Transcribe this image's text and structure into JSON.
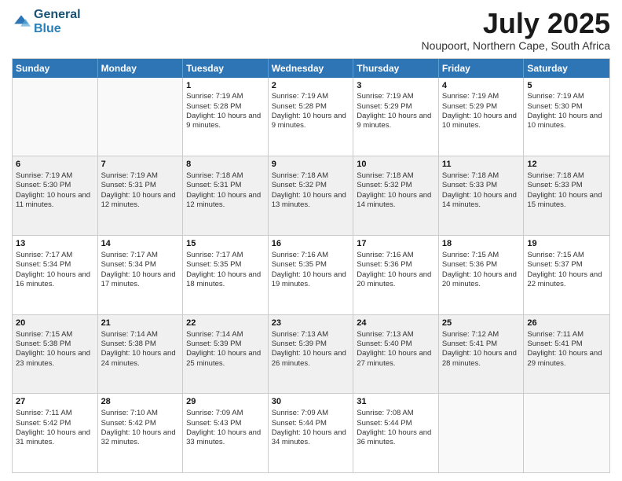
{
  "header": {
    "logo_line1": "General",
    "logo_line2": "Blue",
    "title": "July 2025",
    "subtitle": "Noupoort, Northern Cape, South Africa"
  },
  "calendar": {
    "days_of_week": [
      "Sunday",
      "Monday",
      "Tuesday",
      "Wednesday",
      "Thursday",
      "Friday",
      "Saturday"
    ],
    "weeks": [
      [
        {
          "day": "",
          "info": "",
          "empty": true
        },
        {
          "day": "",
          "info": "",
          "empty": true
        },
        {
          "day": "1",
          "info": "Sunrise: 7:19 AM\nSunset: 5:28 PM\nDaylight: 10 hours and 9 minutes."
        },
        {
          "day": "2",
          "info": "Sunrise: 7:19 AM\nSunset: 5:28 PM\nDaylight: 10 hours and 9 minutes."
        },
        {
          "day": "3",
          "info": "Sunrise: 7:19 AM\nSunset: 5:29 PM\nDaylight: 10 hours and 9 minutes."
        },
        {
          "day": "4",
          "info": "Sunrise: 7:19 AM\nSunset: 5:29 PM\nDaylight: 10 hours and 10 minutes."
        },
        {
          "day": "5",
          "info": "Sunrise: 7:19 AM\nSunset: 5:30 PM\nDaylight: 10 hours and 10 minutes."
        }
      ],
      [
        {
          "day": "6",
          "info": "Sunrise: 7:19 AM\nSunset: 5:30 PM\nDaylight: 10 hours and 11 minutes.",
          "shaded": true
        },
        {
          "day": "7",
          "info": "Sunrise: 7:19 AM\nSunset: 5:31 PM\nDaylight: 10 hours and 12 minutes.",
          "shaded": true
        },
        {
          "day": "8",
          "info": "Sunrise: 7:18 AM\nSunset: 5:31 PM\nDaylight: 10 hours and 12 minutes.",
          "shaded": true
        },
        {
          "day": "9",
          "info": "Sunrise: 7:18 AM\nSunset: 5:32 PM\nDaylight: 10 hours and 13 minutes.",
          "shaded": true
        },
        {
          "day": "10",
          "info": "Sunrise: 7:18 AM\nSunset: 5:32 PM\nDaylight: 10 hours and 14 minutes.",
          "shaded": true
        },
        {
          "day": "11",
          "info": "Sunrise: 7:18 AM\nSunset: 5:33 PM\nDaylight: 10 hours and 14 minutes.",
          "shaded": true
        },
        {
          "day": "12",
          "info": "Sunrise: 7:18 AM\nSunset: 5:33 PM\nDaylight: 10 hours and 15 minutes.",
          "shaded": true
        }
      ],
      [
        {
          "day": "13",
          "info": "Sunrise: 7:17 AM\nSunset: 5:34 PM\nDaylight: 10 hours and 16 minutes."
        },
        {
          "day": "14",
          "info": "Sunrise: 7:17 AM\nSunset: 5:34 PM\nDaylight: 10 hours and 17 minutes."
        },
        {
          "day": "15",
          "info": "Sunrise: 7:17 AM\nSunset: 5:35 PM\nDaylight: 10 hours and 18 minutes."
        },
        {
          "day": "16",
          "info": "Sunrise: 7:16 AM\nSunset: 5:35 PM\nDaylight: 10 hours and 19 minutes."
        },
        {
          "day": "17",
          "info": "Sunrise: 7:16 AM\nSunset: 5:36 PM\nDaylight: 10 hours and 20 minutes."
        },
        {
          "day": "18",
          "info": "Sunrise: 7:15 AM\nSunset: 5:36 PM\nDaylight: 10 hours and 20 minutes."
        },
        {
          "day": "19",
          "info": "Sunrise: 7:15 AM\nSunset: 5:37 PM\nDaylight: 10 hours and 22 minutes."
        }
      ],
      [
        {
          "day": "20",
          "info": "Sunrise: 7:15 AM\nSunset: 5:38 PM\nDaylight: 10 hours and 23 minutes.",
          "shaded": true
        },
        {
          "day": "21",
          "info": "Sunrise: 7:14 AM\nSunset: 5:38 PM\nDaylight: 10 hours and 24 minutes.",
          "shaded": true
        },
        {
          "day": "22",
          "info": "Sunrise: 7:14 AM\nSunset: 5:39 PM\nDaylight: 10 hours and 25 minutes.",
          "shaded": true
        },
        {
          "day": "23",
          "info": "Sunrise: 7:13 AM\nSunset: 5:39 PM\nDaylight: 10 hours and 26 minutes.",
          "shaded": true
        },
        {
          "day": "24",
          "info": "Sunrise: 7:13 AM\nSunset: 5:40 PM\nDaylight: 10 hours and 27 minutes.",
          "shaded": true
        },
        {
          "day": "25",
          "info": "Sunrise: 7:12 AM\nSunset: 5:41 PM\nDaylight: 10 hours and 28 minutes.",
          "shaded": true
        },
        {
          "day": "26",
          "info": "Sunrise: 7:11 AM\nSunset: 5:41 PM\nDaylight: 10 hours and 29 minutes.",
          "shaded": true
        }
      ],
      [
        {
          "day": "27",
          "info": "Sunrise: 7:11 AM\nSunset: 5:42 PM\nDaylight: 10 hours and 31 minutes."
        },
        {
          "day": "28",
          "info": "Sunrise: 7:10 AM\nSunset: 5:42 PM\nDaylight: 10 hours and 32 minutes."
        },
        {
          "day": "29",
          "info": "Sunrise: 7:09 AM\nSunset: 5:43 PM\nDaylight: 10 hours and 33 minutes."
        },
        {
          "day": "30",
          "info": "Sunrise: 7:09 AM\nSunset: 5:44 PM\nDaylight: 10 hours and 34 minutes."
        },
        {
          "day": "31",
          "info": "Sunrise: 7:08 AM\nSunset: 5:44 PM\nDaylight: 10 hours and 36 minutes."
        },
        {
          "day": "",
          "info": "",
          "empty": true
        },
        {
          "day": "",
          "info": "",
          "empty": true
        }
      ]
    ]
  }
}
